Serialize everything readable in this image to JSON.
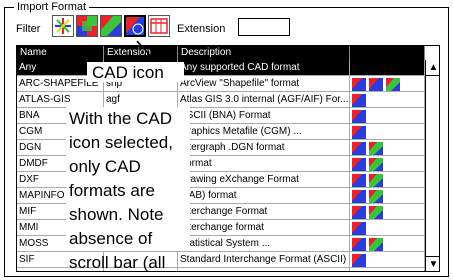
{
  "panel": {
    "title": "Import Format"
  },
  "filter": {
    "label": "Filter",
    "buttons": [
      {
        "icon": "all-formats-icon",
        "selected": false
      },
      {
        "icon": "raster-formats-icon",
        "selected": false
      },
      {
        "icon": "vector-formats-icon",
        "selected": false
      },
      {
        "icon": "cad-formats-icon",
        "selected": true
      },
      {
        "icon": "table-formats-icon",
        "selected": false
      }
    ],
    "extension_label": "Extension",
    "extension_value": ""
  },
  "table": {
    "headers": [
      "Name",
      "Extension",
      "Description",
      ""
    ],
    "rows": [
      {
        "name": "Any",
        "ext": "",
        "desc": "Any supported CAD format",
        "icons": [],
        "selected": true
      },
      {
        "name": "ARC-SHAPEFILE",
        "ext": "shp",
        "desc": "ArcView \"Shapefile\" format",
        "icons": [
          "cad",
          "cad",
          "vector"
        ]
      },
      {
        "name": "ATLAS-GIS",
        "ext": "agf",
        "desc": "Atlas GIS 3.0 internal (AGF/AIF) For...",
        "icons": [
          "cad"
        ]
      },
      {
        "name": "BNA",
        "ext": "",
        "desc": "ASCII (BNA) Format",
        "icons": [
          "cad"
        ]
      },
      {
        "name": "CGM",
        "ext": "",
        "desc": "Graphics Metafile (CGM) ...",
        "icons": [
          "cad"
        ]
      },
      {
        "name": "DGN",
        "ext": "",
        "desc": "Intergraph .DGN format",
        "icons": [
          "cad",
          "vector"
        ]
      },
      {
        "name": "DMDF",
        "ext": "",
        "desc": "Format",
        "icons": [
          "cad",
          "vector"
        ]
      },
      {
        "name": "DXF",
        "ext": "",
        "desc": "Drawing eXchange Format",
        "icons": [
          "cad",
          "vector"
        ]
      },
      {
        "name": "MAPINFO",
        "ext": "",
        "desc": "(TAB) format",
        "icons": [
          "cad",
          "vector"
        ]
      },
      {
        "name": "MIF",
        "ext": "",
        "desc": "Interchange Format",
        "icons": [
          "cad",
          "vector"
        ]
      },
      {
        "name": "MMI",
        "ext": "",
        "desc": "Interchange format",
        "icons": [
          "cad"
        ]
      },
      {
        "name": "MOSS",
        "ext": "",
        "desc": "Statistical System ...",
        "icons": [
          "cad",
          "vector"
        ]
      },
      {
        "name": "SIF",
        "ext": "",
        "desc": "Standard Interchange Format (ASCII)",
        "icons": [
          "cad"
        ]
      },
      {
        "name": "",
        "ext": "",
        "desc": "",
        "icons": []
      }
    ]
  },
  "callouts": {
    "cad_icon": "CAD icon",
    "note": "With the CAD icon selected, only CAD formats are shown. Note absence of scroll bar (all CAD formats shown)."
  },
  "colors": {
    "selected_row_bg": "#000000",
    "header_bg": "#000000",
    "cad_red": "#e8242a",
    "cad_blue": "#2a3dd8",
    "vector_green": "#3cc43c"
  }
}
